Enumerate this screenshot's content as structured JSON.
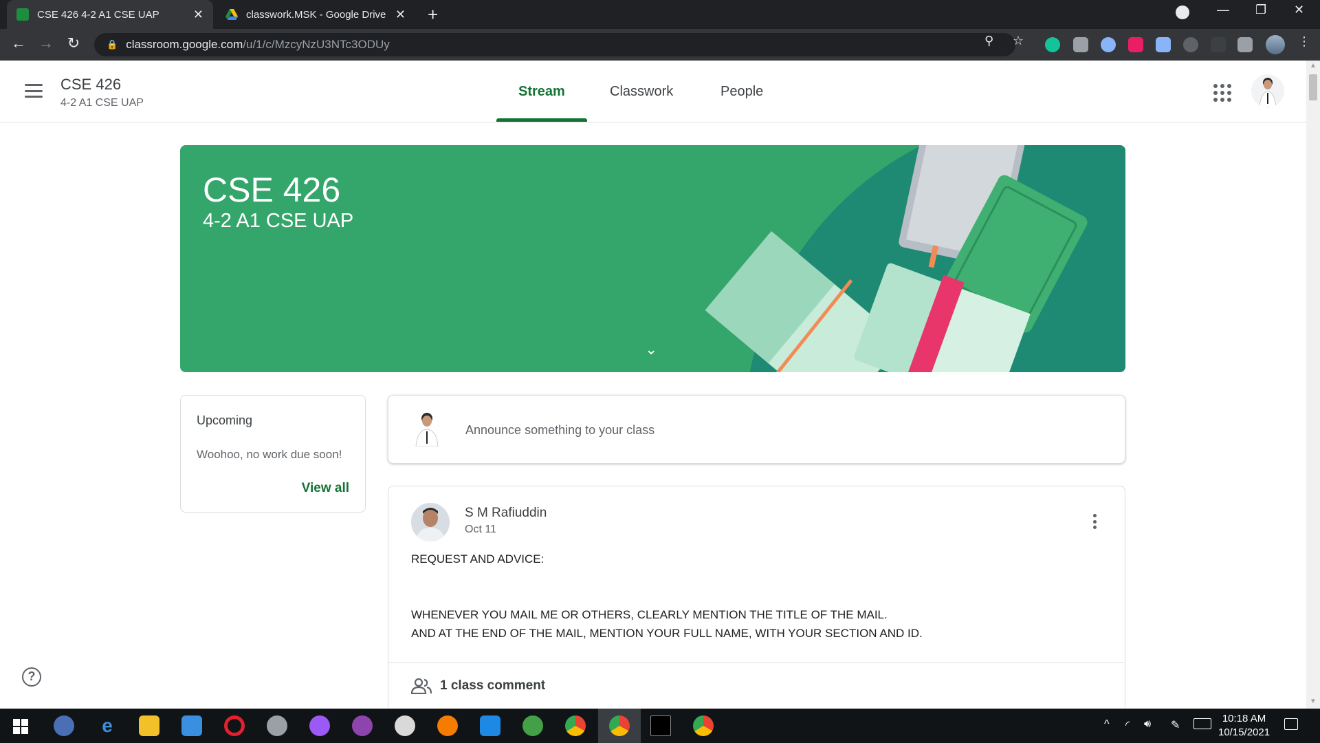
{
  "browser": {
    "tabs": [
      {
        "title": "CSE 426 4-2 A1 CSE UAP",
        "favicon": "google-classroom-icon",
        "active": true
      },
      {
        "title": "classwork.MSK - Google Drive",
        "favicon": "google-drive-icon",
        "active": false
      }
    ],
    "url_host": "classroom.google.com",
    "url_path": "/u/1/c/MzcyNzU3NTc3ODUy"
  },
  "header": {
    "class_name": "CSE 426",
    "class_section": "4-2 A1 CSE UAP",
    "tabs": [
      "Stream",
      "Classwork",
      "People"
    ],
    "active_tab": "Stream"
  },
  "banner": {
    "title": "CSE 426",
    "subtitle": "4-2 A1 CSE UAP",
    "color": "#34a66b"
  },
  "upcoming": {
    "title": "Upcoming",
    "empty_text": "Woohoo, no work due soon!",
    "view_all": "View all"
  },
  "announce": {
    "placeholder": "Announce something to your class"
  },
  "post": {
    "author": "S M Rafiuddin",
    "date": "Oct 11",
    "lines": [
      "REQUEST AND ADVICE:",
      "",
      "WHENEVER YOU MAIL ME OR OTHERS, CLEARLY MENTION THE TITLE OF THE MAIL.",
      "AND AT THE END OF THE MAIL, MENTION YOUR FULL NAME, WITH YOUR SECTION AND ID."
    ],
    "comments": "1 class comment"
  },
  "taskbar": {
    "time": "10:18 AM",
    "date": "10/15/2021"
  },
  "colors": {
    "accent": "#137333",
    "chrome_dark": "#202124",
    "banner_green": "#34a66b"
  }
}
